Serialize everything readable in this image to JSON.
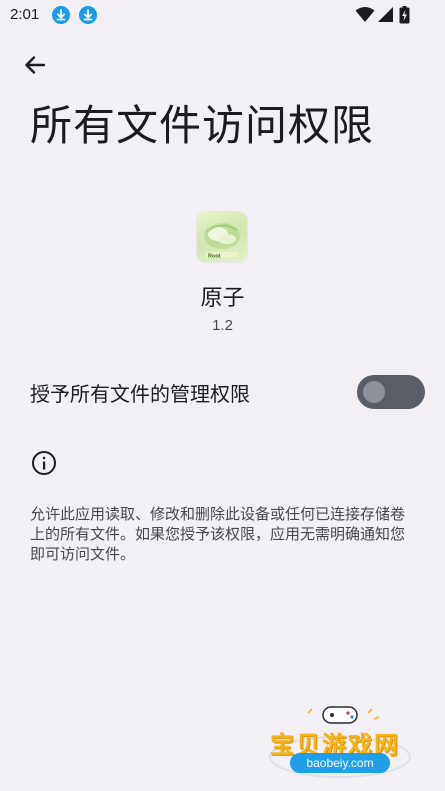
{
  "status_bar": {
    "time": "2:01",
    "icons": [
      "download-icon",
      "download-icon",
      "wifi-icon",
      "signal-icon",
      "battery-charging-icon"
    ]
  },
  "header": {
    "back_icon": "arrow-left-icon",
    "title": "所有文件访问权限"
  },
  "app": {
    "icon": "app-icon",
    "name": "原子",
    "version": "1.2"
  },
  "permission_toggle": {
    "label": "授予所有文件的管理权限",
    "enabled": false
  },
  "info": {
    "icon": "info-icon",
    "description": "允许此应用读取、修改和删除此设备或任何已连接存储卷上的所有文件。如果您授予该权限，应用无需明确通知您即可访问文件。"
  },
  "watermark": {
    "text": "宝贝游戏网",
    "url": "baobeiy.com"
  },
  "colors": {
    "background": "#f2f0f5",
    "text_primary": "#1c1b1f",
    "text_secondary": "#49454f",
    "toggle_track_off": "#5a5d66",
    "toggle_thumb_off": "#8e9199",
    "download_badge": "#1a9be8"
  }
}
